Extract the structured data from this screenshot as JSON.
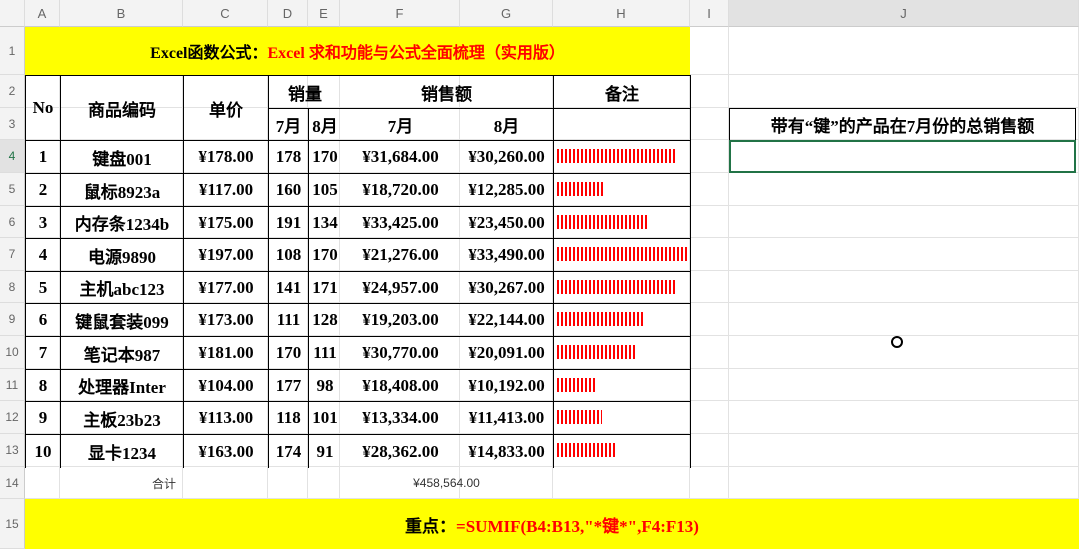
{
  "columns": [
    "A",
    "B",
    "C",
    "D",
    "E",
    "F",
    "G",
    "H",
    "I",
    "J"
  ],
  "rows": [
    "1",
    "2",
    "3",
    "4",
    "5",
    "6",
    "7",
    "8",
    "9",
    "10",
    "11",
    "12",
    "13",
    "14",
    "15"
  ],
  "title": {
    "black": "Excel函数公式：",
    "red": "Excel 求和功能与公式全面梳理（实用版）"
  },
  "headers": {
    "no": "No",
    "code": "商品编码",
    "price": "单价",
    "qty": "销量",
    "sales": "销售额",
    "note": "备注",
    "m7": "7月",
    "m8": "8月"
  },
  "items": [
    {
      "no": "1",
      "code": "键盘001",
      "price": "¥178.00",
      "q7": "178",
      "q8": "170",
      "s7": "¥31,684.00",
      "s8": "¥30,260.00",
      "bar": 30260
    },
    {
      "no": "2",
      "code": "鼠标8923a",
      "price": "¥117.00",
      "q7": "160",
      "q8": "105",
      "s7": "¥18,720.00",
      "s8": "¥12,285.00",
      "bar": 12285
    },
    {
      "no": "3",
      "code": "内存条1234b",
      "price": "¥175.00",
      "q7": "191",
      "q8": "134",
      "s7": "¥33,425.00",
      "s8": "¥23,450.00",
      "bar": 23450
    },
    {
      "no": "4",
      "code": "电源9890",
      "price": "¥197.00",
      "q7": "108",
      "q8": "170",
      "s7": "¥21,276.00",
      "s8": "¥33,490.00",
      "bar": 33490
    },
    {
      "no": "5",
      "code": "主机abc123",
      "price": "¥177.00",
      "q7": "141",
      "q8": "171",
      "s7": "¥24,957.00",
      "s8": "¥30,267.00",
      "bar": 30267
    },
    {
      "no": "6",
      "code": "键鼠套装099",
      "price": "¥173.00",
      "q7": "111",
      "q8": "128",
      "s7": "¥19,203.00",
      "s8": "¥22,144.00",
      "bar": 22144
    },
    {
      "no": "7",
      "code": "笔记本987",
      "price": "¥181.00",
      "q7": "170",
      "q8": "111",
      "s7": "¥30,770.00",
      "s8": "¥20,091.00",
      "bar": 20091
    },
    {
      "no": "8",
      "code": "处理器Inter",
      "price": "¥104.00",
      "q7": "177",
      "q8": "98",
      "s7": "¥18,408.00",
      "s8": "¥10,192.00",
      "bar": 10192
    },
    {
      "no": "9",
      "code": "主板23b23",
      "price": "¥113.00",
      "q7": "118",
      "q8": "101",
      "s7": "¥13,334.00",
      "s8": "¥11,413.00",
      "bar": 11413
    },
    {
      "no": "10",
      "code": "显卡1234",
      "price": "¥163.00",
      "q7": "174",
      "q8": "91",
      "s7": "¥28,362.00",
      "s8": "¥14,833.00",
      "bar": 14833
    }
  ],
  "total": {
    "label": "合计",
    "value": "¥458,564.00"
  },
  "question": "带有“键”的产品在7月份的总销售额",
  "answer": "",
  "footer": {
    "label": "重点：",
    "formula": "=SUMIF(B4:B13,\"*键*\",F4:F13)"
  },
  "colors": {
    "yellow": "#ffff00",
    "red": "#ff0000",
    "select": "#217346"
  }
}
